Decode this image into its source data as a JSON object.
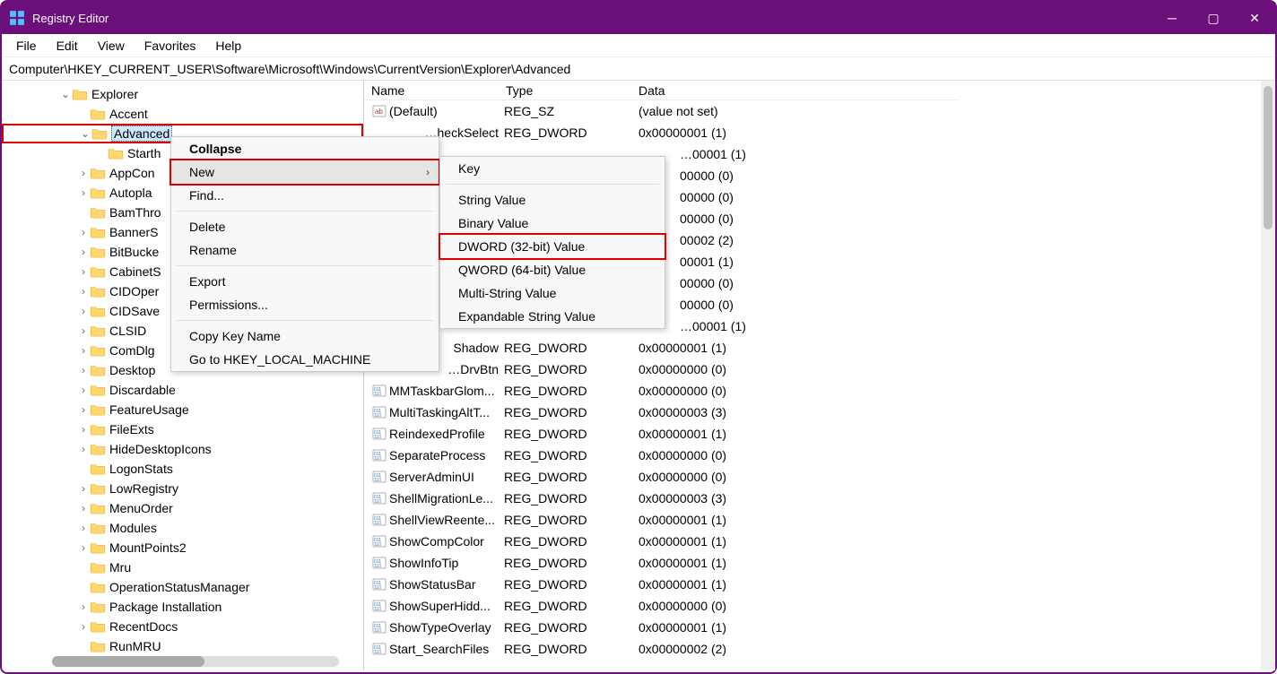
{
  "window": {
    "title": "Registry Editor"
  },
  "menubar": [
    "File",
    "Edit",
    "View",
    "Favorites",
    "Help"
  ],
  "address": "Computer\\HKEY_CURRENT_USER\\Software\\Microsoft\\Windows\\CurrentVersion\\Explorer\\Advanced",
  "tree": {
    "root": "Explorer",
    "selected": "Advanced",
    "children": [
      {
        "label": "Accent",
        "expander": "",
        "indent": 1
      },
      {
        "label": "Advanced",
        "expander": "v",
        "indent": 1,
        "selected": true
      },
      {
        "label": "Starth",
        "expander": "",
        "indent": 2
      },
      {
        "label": "AppCon",
        "expander": ">",
        "indent": 1
      },
      {
        "label": "Autopla",
        "expander": ">",
        "indent": 1
      },
      {
        "label": "BamThro",
        "expander": "",
        "indent": 1
      },
      {
        "label": "BannerS",
        "expander": ">",
        "indent": 1
      },
      {
        "label": "BitBucke",
        "expander": ">",
        "indent": 1
      },
      {
        "label": "CabinetS",
        "expander": ">",
        "indent": 1
      },
      {
        "label": "CIDOper",
        "expander": ">",
        "indent": 1
      },
      {
        "label": "CIDSave",
        "expander": ">",
        "indent": 1
      },
      {
        "label": "CLSID",
        "expander": ">",
        "indent": 1
      },
      {
        "label": "ComDlg",
        "expander": ">",
        "indent": 1
      },
      {
        "label": "Desktop",
        "expander": ">",
        "indent": 1
      },
      {
        "label": "Discardable",
        "expander": ">",
        "indent": 1
      },
      {
        "label": "FeatureUsage",
        "expander": ">",
        "indent": 1
      },
      {
        "label": "FileExts",
        "expander": ">",
        "indent": 1
      },
      {
        "label": "HideDesktopIcons",
        "expander": ">",
        "indent": 1
      },
      {
        "label": "LogonStats",
        "expander": "",
        "indent": 1
      },
      {
        "label": "LowRegistry",
        "expander": ">",
        "indent": 1
      },
      {
        "label": "MenuOrder",
        "expander": ">",
        "indent": 1
      },
      {
        "label": "Modules",
        "expander": ">",
        "indent": 1
      },
      {
        "label": "MountPoints2",
        "expander": ">",
        "indent": 1
      },
      {
        "label": "Mru",
        "expander": "",
        "indent": 1
      },
      {
        "label": "OperationStatusManager",
        "expander": "",
        "indent": 1
      },
      {
        "label": "Package Installation",
        "expander": ">",
        "indent": 1
      },
      {
        "label": "RecentDocs",
        "expander": ">",
        "indent": 1
      },
      {
        "label": "RunMRU",
        "expander": "",
        "indent": 1
      }
    ]
  },
  "values_header": {
    "name": "Name",
    "type": "Type",
    "data": "Data"
  },
  "values": [
    {
      "icon": "ab",
      "name": "(Default)",
      "type": "REG_SZ",
      "data": "(value not set)"
    },
    {
      "icon": "bin",
      "name": "…heckSelect",
      "type": "REG_DWORD",
      "data": "0x00000001 (1)",
      "clipLeft": true
    },
    {
      "icon": "bin",
      "name": "",
      "type": "",
      "data": "…00001 (1)",
      "partial": true
    },
    {
      "icon": "bin",
      "name": "",
      "type": "",
      "data": "00000 (0)",
      "partial": true
    },
    {
      "icon": "bin",
      "name": "",
      "type": "",
      "data": "00000 (0)",
      "partial": true
    },
    {
      "icon": "bin",
      "name": "",
      "type": "",
      "data": "00000 (0)",
      "partial": true
    },
    {
      "icon": "bin",
      "name": "",
      "type": "",
      "data": "00002 (2)",
      "partial": true
    },
    {
      "icon": "bin",
      "name": "",
      "type": "",
      "data": "00001 (1)",
      "partial": true
    },
    {
      "icon": "bin",
      "name": "",
      "type": "",
      "data": "00000 (0)",
      "partial": true
    },
    {
      "icon": "bin",
      "name": "",
      "type": "",
      "data": "00000 (0)",
      "partial": true
    },
    {
      "icon": "bin",
      "name": "",
      "type": "",
      "data": "…00001 (1)",
      "partial": true,
      "tailOnlyName": "…"
    },
    {
      "icon": "bin",
      "name": "Shadow",
      "type": "REG_DWORD",
      "data": "0x00000001 (1)",
      "clipLeft": true
    },
    {
      "icon": "bin",
      "name": "…DrvBtn",
      "type": "REG_DWORD",
      "data": "0x00000000 (0)",
      "clipLeft": true
    },
    {
      "icon": "bin",
      "name": "MMTaskbarGlom...",
      "type": "REG_DWORD",
      "data": "0x00000000 (0)"
    },
    {
      "icon": "bin",
      "name": "MultiTaskingAltT...",
      "type": "REG_DWORD",
      "data": "0x00000003 (3)"
    },
    {
      "icon": "bin",
      "name": "ReindexedProfile",
      "type": "REG_DWORD",
      "data": "0x00000001 (1)"
    },
    {
      "icon": "bin",
      "name": "SeparateProcess",
      "type": "REG_DWORD",
      "data": "0x00000000 (0)"
    },
    {
      "icon": "bin",
      "name": "ServerAdminUI",
      "type": "REG_DWORD",
      "data": "0x00000000 (0)"
    },
    {
      "icon": "bin",
      "name": "ShellMigrationLe...",
      "type": "REG_DWORD",
      "data": "0x00000003 (3)"
    },
    {
      "icon": "bin",
      "name": "ShellViewReente...",
      "type": "REG_DWORD",
      "data": "0x00000001 (1)"
    },
    {
      "icon": "bin",
      "name": "ShowCompColor",
      "type": "REG_DWORD",
      "data": "0x00000001 (1)"
    },
    {
      "icon": "bin",
      "name": "ShowInfoTip",
      "type": "REG_DWORD",
      "data": "0x00000001 (1)"
    },
    {
      "icon": "bin",
      "name": "ShowStatusBar",
      "type": "REG_DWORD",
      "data": "0x00000001 (1)"
    },
    {
      "icon": "bin",
      "name": "ShowSuperHidd...",
      "type": "REG_DWORD",
      "data": "0x00000000 (0)"
    },
    {
      "icon": "bin",
      "name": "ShowTypeOverlay",
      "type": "REG_DWORD",
      "data": "0x00000001 (1)"
    },
    {
      "icon": "bin",
      "name": "Start_SearchFiles",
      "type": "REG_DWORD",
      "data": "0x00000002 (2)"
    }
  ],
  "context_menu": {
    "items": [
      {
        "label": "Collapse",
        "bold": true
      },
      {
        "label": "New",
        "hover": true,
        "arrow": true,
        "new": true
      },
      {
        "label": "Find..."
      },
      {
        "sep": true
      },
      {
        "label": "Delete"
      },
      {
        "label": "Rename"
      },
      {
        "sep": true
      },
      {
        "label": "Export"
      },
      {
        "label": "Permissions..."
      },
      {
        "sep": true
      },
      {
        "label": "Copy Key Name"
      },
      {
        "label": "Go to HKEY_LOCAL_MACHINE"
      }
    ]
  },
  "submenu": {
    "items": [
      {
        "label": "Key"
      },
      {
        "sep": true
      },
      {
        "label": "String Value"
      },
      {
        "label": "Binary Value"
      },
      {
        "label": "DWORD (32-bit) Value",
        "dword": true
      },
      {
        "label": "QWORD (64-bit) Value"
      },
      {
        "label": "Multi-String Value"
      },
      {
        "label": "Expandable String Value"
      }
    ]
  }
}
